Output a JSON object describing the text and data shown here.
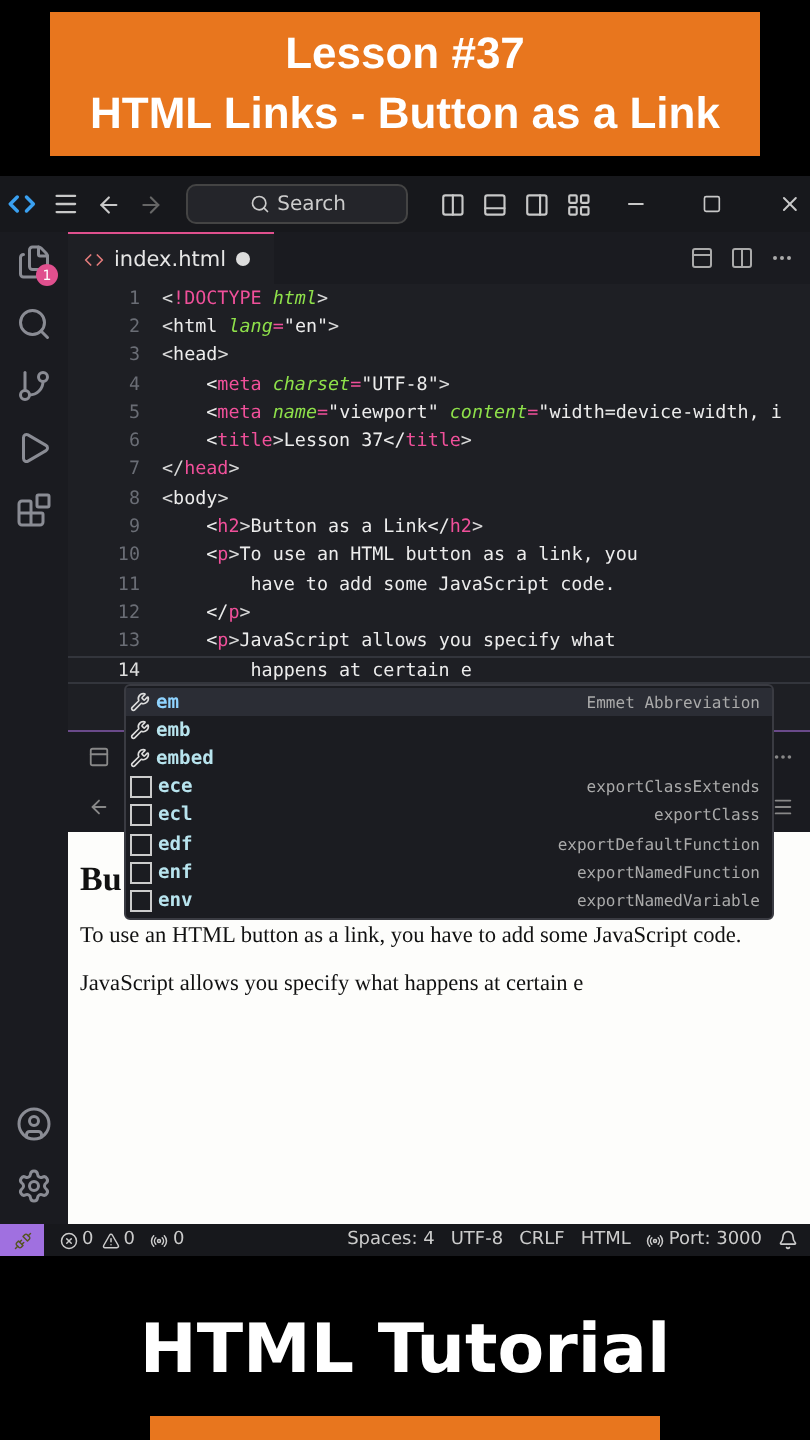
{
  "banner": {
    "lines": [
      "Lesson #37",
      "HTML Links - Button as a Link"
    ]
  },
  "titlebar": {
    "search": {
      "placeholder": "Search"
    }
  },
  "activity_bar": {
    "badge": "1"
  },
  "tabs": [
    {
      "label": "index.html",
      "modified": true,
      "selected": true
    }
  ],
  "editor": {
    "lines": [
      {
        "number": "1",
        "current": false,
        "tokens": [
          {
            "kind": "punct",
            "text": "<"
          },
          {
            "kind": "tag",
            "text": "!DOCTYPE"
          },
          {
            "kind": "attr",
            "text": " html"
          },
          {
            "kind": "punct",
            "text": ">"
          }
        ]
      },
      {
        "number": "2",
        "current": false,
        "tokens": [
          {
            "kind": "punct",
            "text": "<"
          },
          {
            "kind": "text",
            "text": "html "
          },
          {
            "kind": "attr",
            "text": "lang"
          },
          {
            "kind": "eq",
            "text": "="
          },
          {
            "kind": "str",
            "text": "\"en\""
          },
          {
            "kind": "punct",
            "text": ">"
          }
        ]
      },
      {
        "number": "3",
        "current": false,
        "tokens": [
          {
            "kind": "punct",
            "text": "<"
          },
          {
            "kind": "text",
            "text": "head"
          },
          {
            "kind": "punct",
            "text": ">"
          }
        ]
      },
      {
        "number": "4",
        "current": false,
        "tokens": [
          {
            "kind": "text",
            "text": "    <"
          },
          {
            "kind": "tag",
            "text": "meta"
          },
          {
            "kind": "attr",
            "text": " charset"
          },
          {
            "kind": "eq",
            "text": "="
          },
          {
            "kind": "str",
            "text": "\"UTF-8\""
          },
          {
            "kind": "punct",
            "text": ">"
          }
        ]
      },
      {
        "number": "5",
        "current": false,
        "tokens": [
          {
            "kind": "text",
            "text": "    <"
          },
          {
            "kind": "tag",
            "text": "meta"
          },
          {
            "kind": "attr",
            "text": " name"
          },
          {
            "kind": "eq",
            "text": "="
          },
          {
            "kind": "str",
            "text": "\"viewport\" "
          },
          {
            "kind": "attr",
            "text": "content"
          },
          {
            "kind": "eq",
            "text": "="
          },
          {
            "kind": "str",
            "text": "\"width=device-width, i"
          }
        ]
      },
      {
        "number": "6",
        "current": false,
        "tokens": [
          {
            "kind": "text",
            "text": "    <"
          },
          {
            "kind": "tag",
            "text": "title"
          },
          {
            "kind": "punct",
            "text": ">"
          },
          {
            "kind": "text",
            "text": "Lesson 37</"
          },
          {
            "kind": "tag",
            "text": "title"
          },
          {
            "kind": "punct",
            "text": ">"
          }
        ]
      },
      {
        "number": "7",
        "current": false,
        "tokens": [
          {
            "kind": "punct",
            "text": "</"
          },
          {
            "kind": "tag",
            "text": "head"
          },
          {
            "kind": "punct",
            "text": ">"
          }
        ]
      },
      {
        "number": "8",
        "current": false,
        "tokens": [
          {
            "kind": "punct",
            "text": "<"
          },
          {
            "kind": "text",
            "text": "body"
          },
          {
            "kind": "punct",
            "text": ">"
          }
        ]
      },
      {
        "number": "9",
        "current": false,
        "tokens": [
          {
            "kind": "text",
            "text": "    <"
          },
          {
            "kind": "tag",
            "text": "h2"
          },
          {
            "kind": "punct",
            "text": ">"
          },
          {
            "kind": "text",
            "text": "Button as a Link</"
          },
          {
            "kind": "tag",
            "text": "h2"
          },
          {
            "kind": "punct",
            "text": ">"
          }
        ]
      },
      {
        "number": "10",
        "current": false,
        "tokens": [
          {
            "kind": "text",
            "text": "    <"
          },
          {
            "kind": "tag",
            "text": "p"
          },
          {
            "kind": "punct",
            "text": ">"
          },
          {
            "kind": "text",
            "text": "To use an HTML button as a link, you"
          }
        ]
      },
      {
        "number": "11",
        "current": false,
        "tokens": [
          {
            "kind": "text",
            "text": "        have to add some JavaScript code."
          }
        ]
      },
      {
        "number": "12",
        "current": false,
        "tokens": [
          {
            "kind": "text",
            "text": "    </"
          },
          {
            "kind": "tag",
            "text": "p"
          },
          {
            "kind": "punct",
            "text": ">"
          }
        ]
      },
      {
        "number": "13",
        "current": false,
        "tokens": [
          {
            "kind": "text",
            "text": "    <"
          },
          {
            "kind": "tag",
            "text": "p"
          },
          {
            "kind": "punct",
            "text": ">"
          },
          {
            "kind": "text",
            "text": "JavaScript allows you specify what"
          }
        ]
      },
      {
        "number": "14",
        "current": true,
        "tokens": [
          {
            "kind": "text",
            "text": "        happens at certain e"
          }
        ]
      }
    ]
  },
  "suggestions": [
    {
      "label": "em",
      "detail": "Emmet Abbreviation",
      "kind": "emmet",
      "selected": true
    },
    {
      "label": "emb",
      "kind": "emmet",
      "selected": false
    },
    {
      "label": "embed",
      "kind": "emmet",
      "selected": false
    },
    {
      "label": "ece",
      "detail": "exportClassExtends",
      "kind": "snippet",
      "selected": false
    },
    {
      "label": "ecl",
      "detail": "exportClass",
      "kind": "snippet",
      "selected": false
    },
    {
      "label": "edf",
      "detail": "exportDefaultFunction",
      "kind": "snippet",
      "selected": false
    },
    {
      "label": "enf",
      "detail": "exportNamedFunction",
      "kind": "snippet",
      "selected": false
    },
    {
      "label": "env",
      "detail": "exportNamedVariable",
      "kind": "snippet",
      "selected": false
    }
  ],
  "preview": {
    "heading": "Bu",
    "paragraphs": [
      "To use an HTML button as a link, you have to add some JavaScript code.",
      "JavaScript allows you specify what happens at certain e"
    ]
  },
  "status_bar": {
    "errors": "0",
    "warnings": "0",
    "ports": "0",
    "right": [
      "Spaces: 4",
      "UTF-8",
      "CRLF",
      "HTML"
    ],
    "port": "Port: 3000"
  },
  "footer": {
    "title": "HTML Tutorial"
  }
}
